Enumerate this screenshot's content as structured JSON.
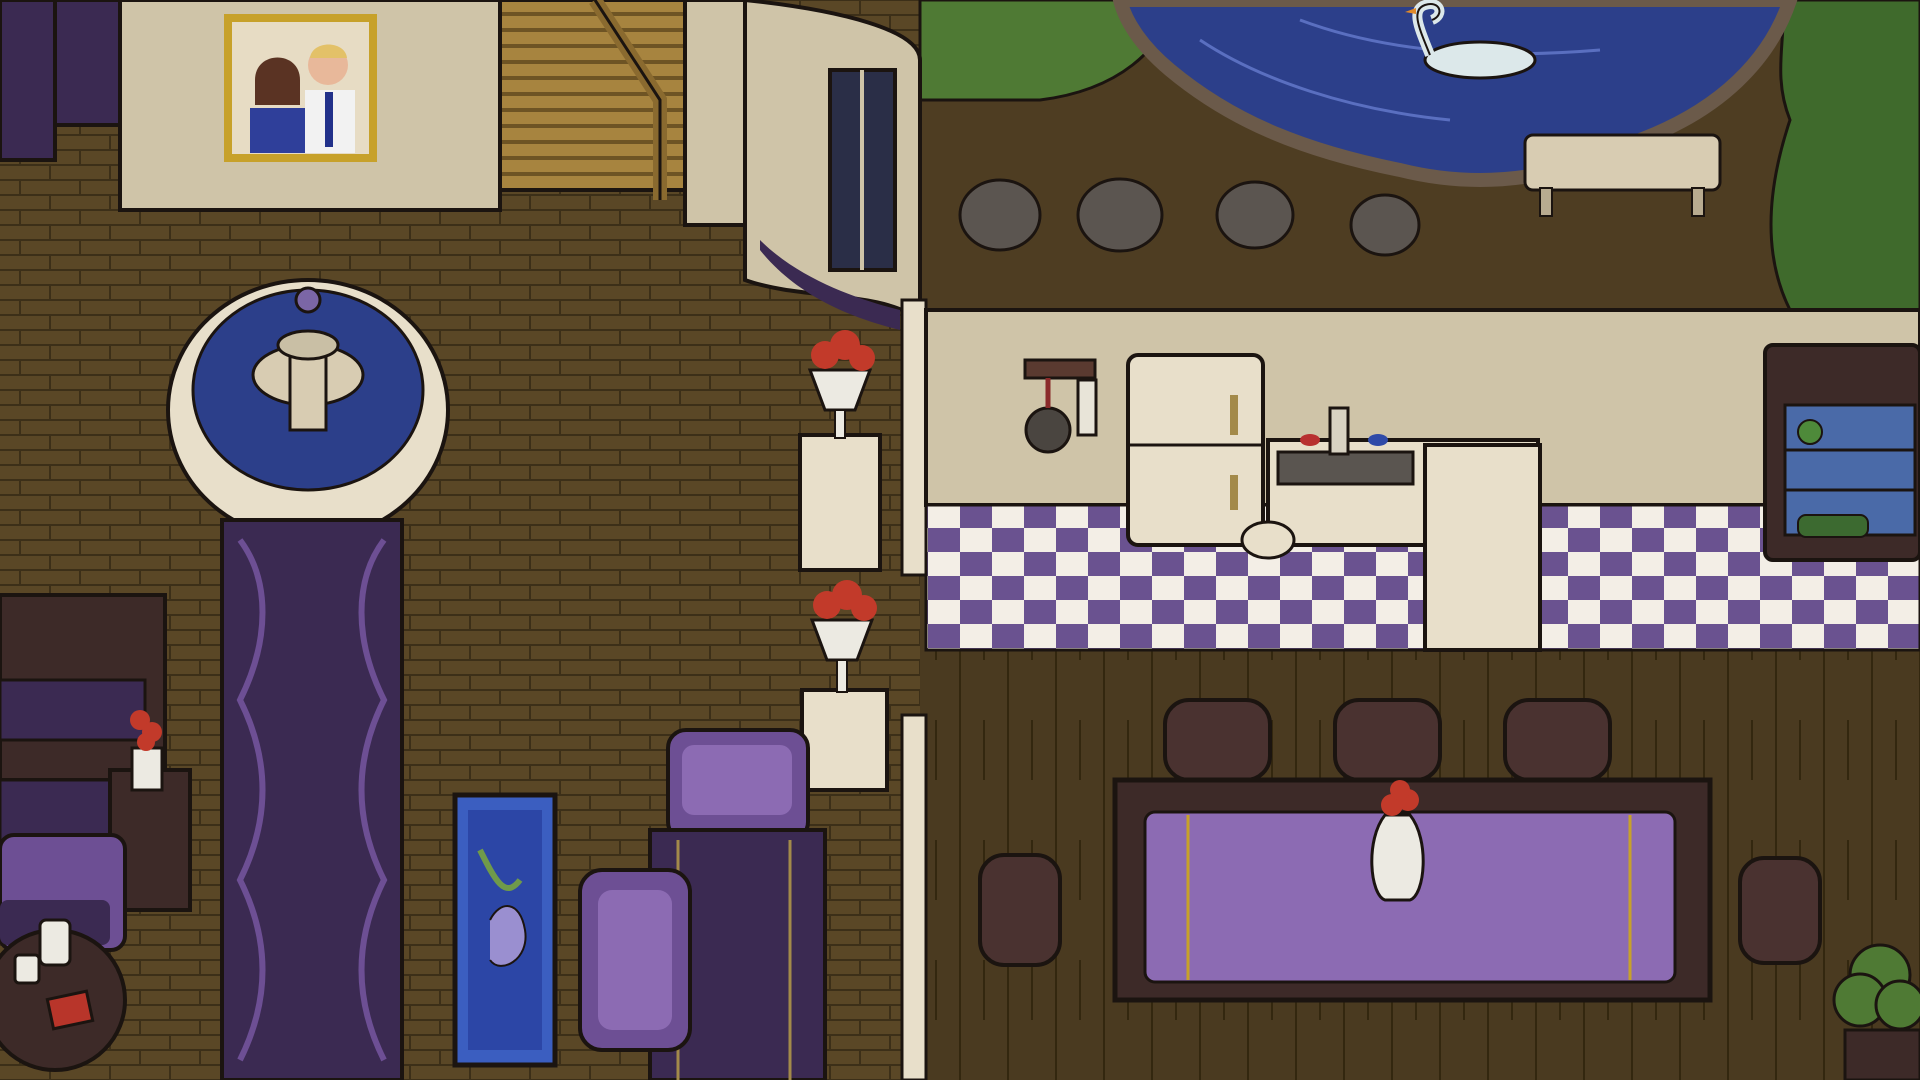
{
  "scene": {
    "view": "top-down",
    "palette": {
      "brick_floor": "#5a4726",
      "brick_line": "#3c2f18",
      "wall_cream": "#cfc4a8",
      "purple_dark": "#3b2a52",
      "purple_mid": "#6d4f94",
      "purple_light": "#8c6bb3",
      "wood_dark": "#3d2a28",
      "pond_blue": "#2c3f8a",
      "grass": "#4f7a34",
      "dirt": "#4e3d22",
      "checker_purple": "#6a5290",
      "checker_white": "#f3eee6",
      "rose_red": "#c23a2a",
      "outline": "#1b1410"
    },
    "icons": [
      "family-portrait",
      "grand-staircase",
      "stone-fountain",
      "purple-carpet-runner",
      "rose-vase",
      "pedestal",
      "fish-tank-aquarium",
      "purple-armchair",
      "purple-sofa",
      "piano",
      "side-table",
      "round-table",
      "pitcher",
      "cup",
      "book",
      "garden-pond",
      "swan",
      "stepping-stones",
      "garden-bench",
      "hedge",
      "pan-rack",
      "refrigerator",
      "kitchen-sink",
      "stool",
      "kitchen-counter",
      "wine-shelf",
      "dining-table",
      "dining-chair",
      "potted-plant"
    ]
  }
}
